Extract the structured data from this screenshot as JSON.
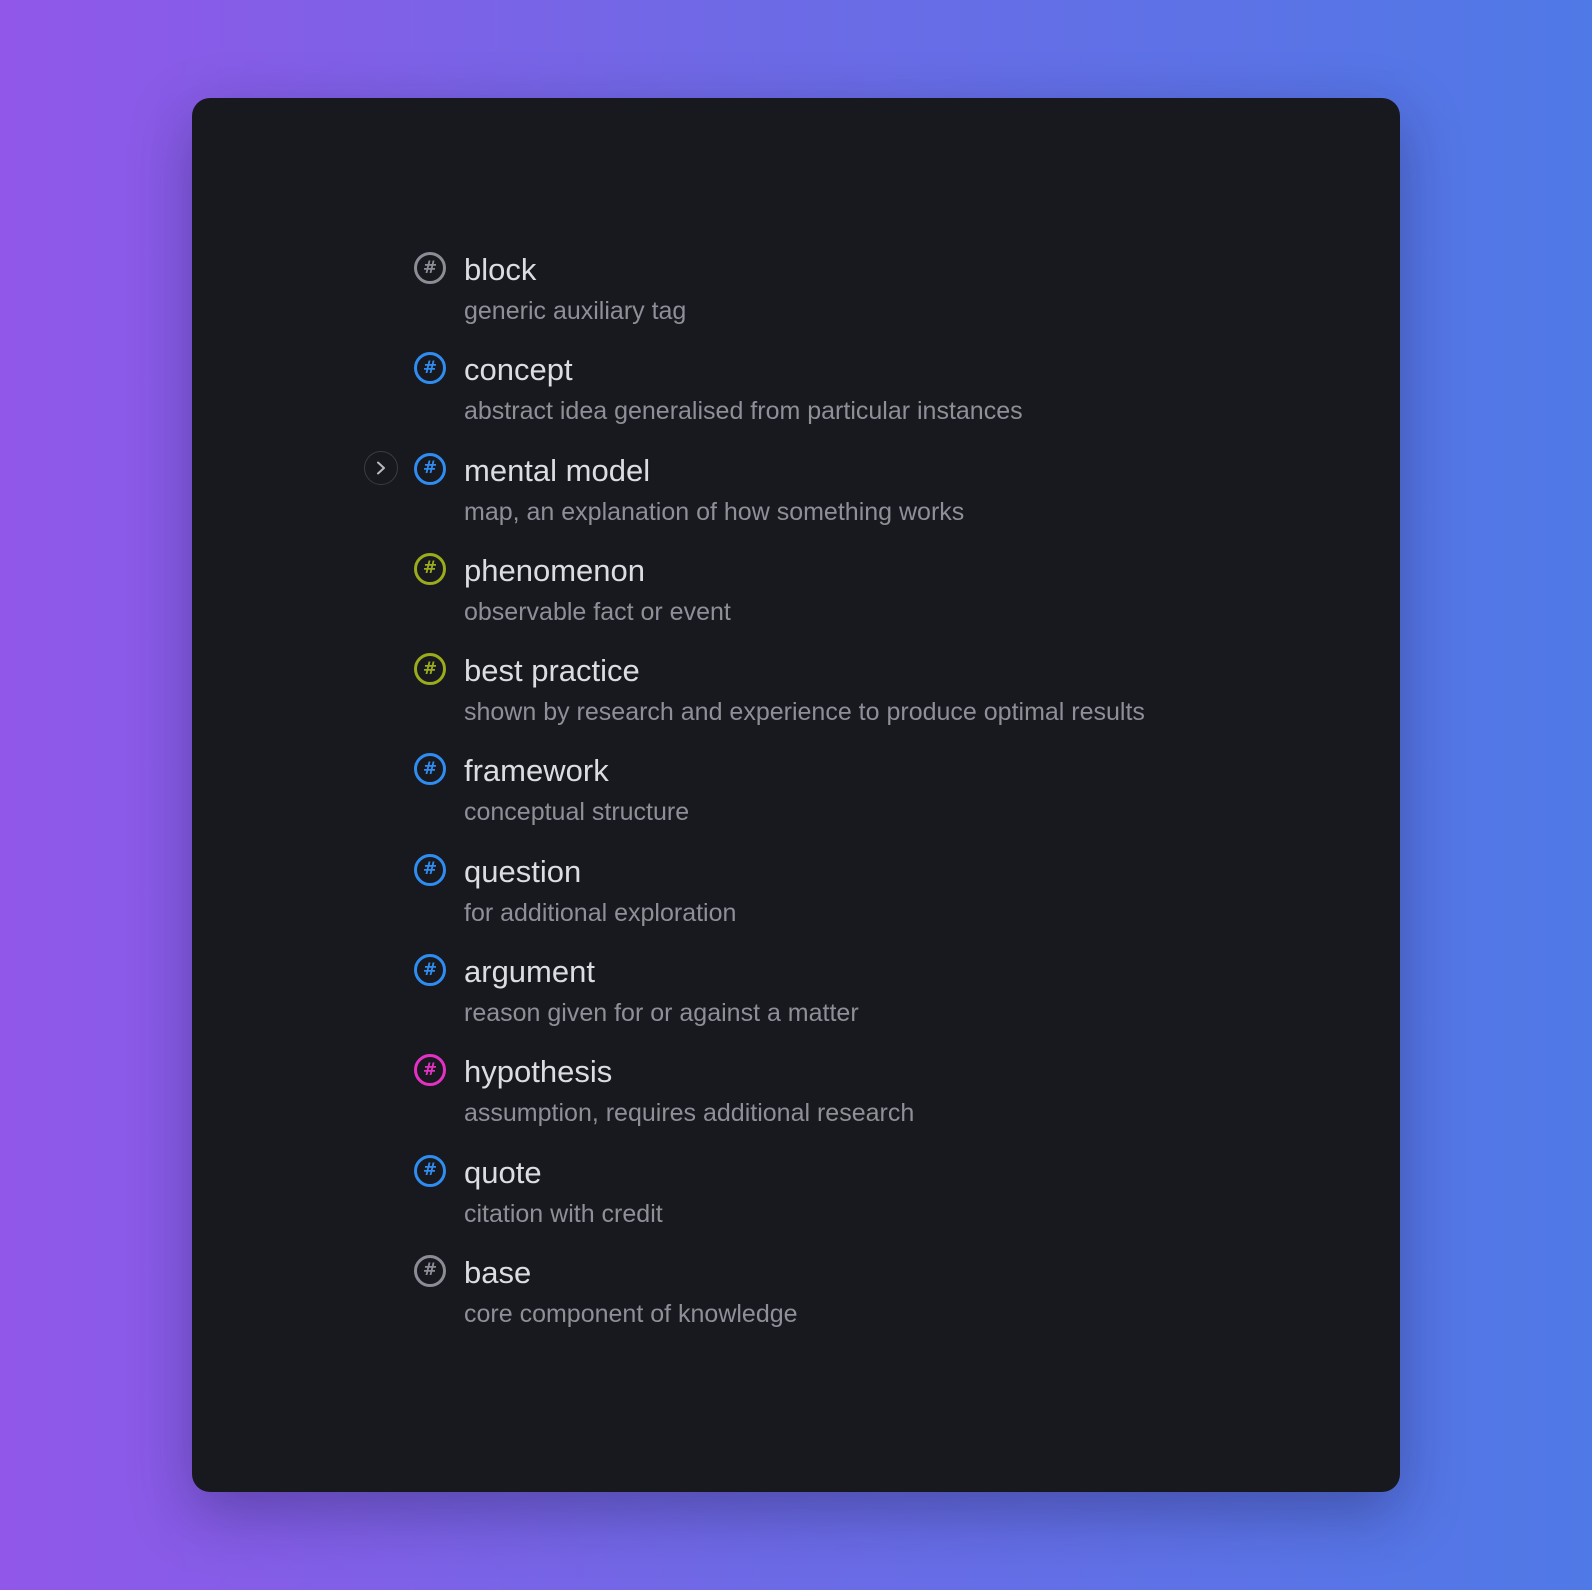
{
  "tags": [
    {
      "name": "block",
      "description": "generic auxiliary tag",
      "color": "#8b8d96",
      "icon": "hash-icon",
      "expandable": false
    },
    {
      "name": "concept",
      "description": "abstract idea generalised from particular instances",
      "color": "#2f8cf0",
      "icon": "hash-icon",
      "expandable": false
    },
    {
      "name": "mental model",
      "description": "map, an explanation of how something works",
      "color": "#2f8cf0",
      "icon": "hash-icon",
      "expandable": true
    },
    {
      "name": "phenomenon",
      "description": "observable fact or event",
      "color": "#9aab1c",
      "icon": "hash-icon",
      "expandable": false
    },
    {
      "name": "best practice",
      "description": "shown by research and experience to produce optimal results",
      "color": "#9aab1c",
      "icon": "hash-icon",
      "expandable": false
    },
    {
      "name": "framework",
      "description": "conceptual structure",
      "color": "#2f8cf0",
      "icon": "hash-icon",
      "expandable": false
    },
    {
      "name": "question",
      "description": "for additional exploration",
      "color": "#2f8cf0",
      "icon": "hash-icon",
      "expandable": false
    },
    {
      "name": "argument",
      "description": "reason given for or against a matter",
      "color": "#2f8cf0",
      "icon": "hash-icon",
      "expandable": false
    },
    {
      "name": "hypothesis",
      "description": "assumption, requires additional research",
      "color": "#e331c6",
      "icon": "hash-icon",
      "expandable": false
    },
    {
      "name": "quote",
      "description": "citation with credit",
      "color": "#2f8cf0",
      "icon": "hash-icon",
      "expandable": false
    },
    {
      "name": "base",
      "description": "core component of knowledge",
      "color": "#8b8d96",
      "icon": "hash-icon",
      "expandable": false
    }
  ],
  "expand_icon": "chevron-right-icon",
  "hash_symbol": "#"
}
